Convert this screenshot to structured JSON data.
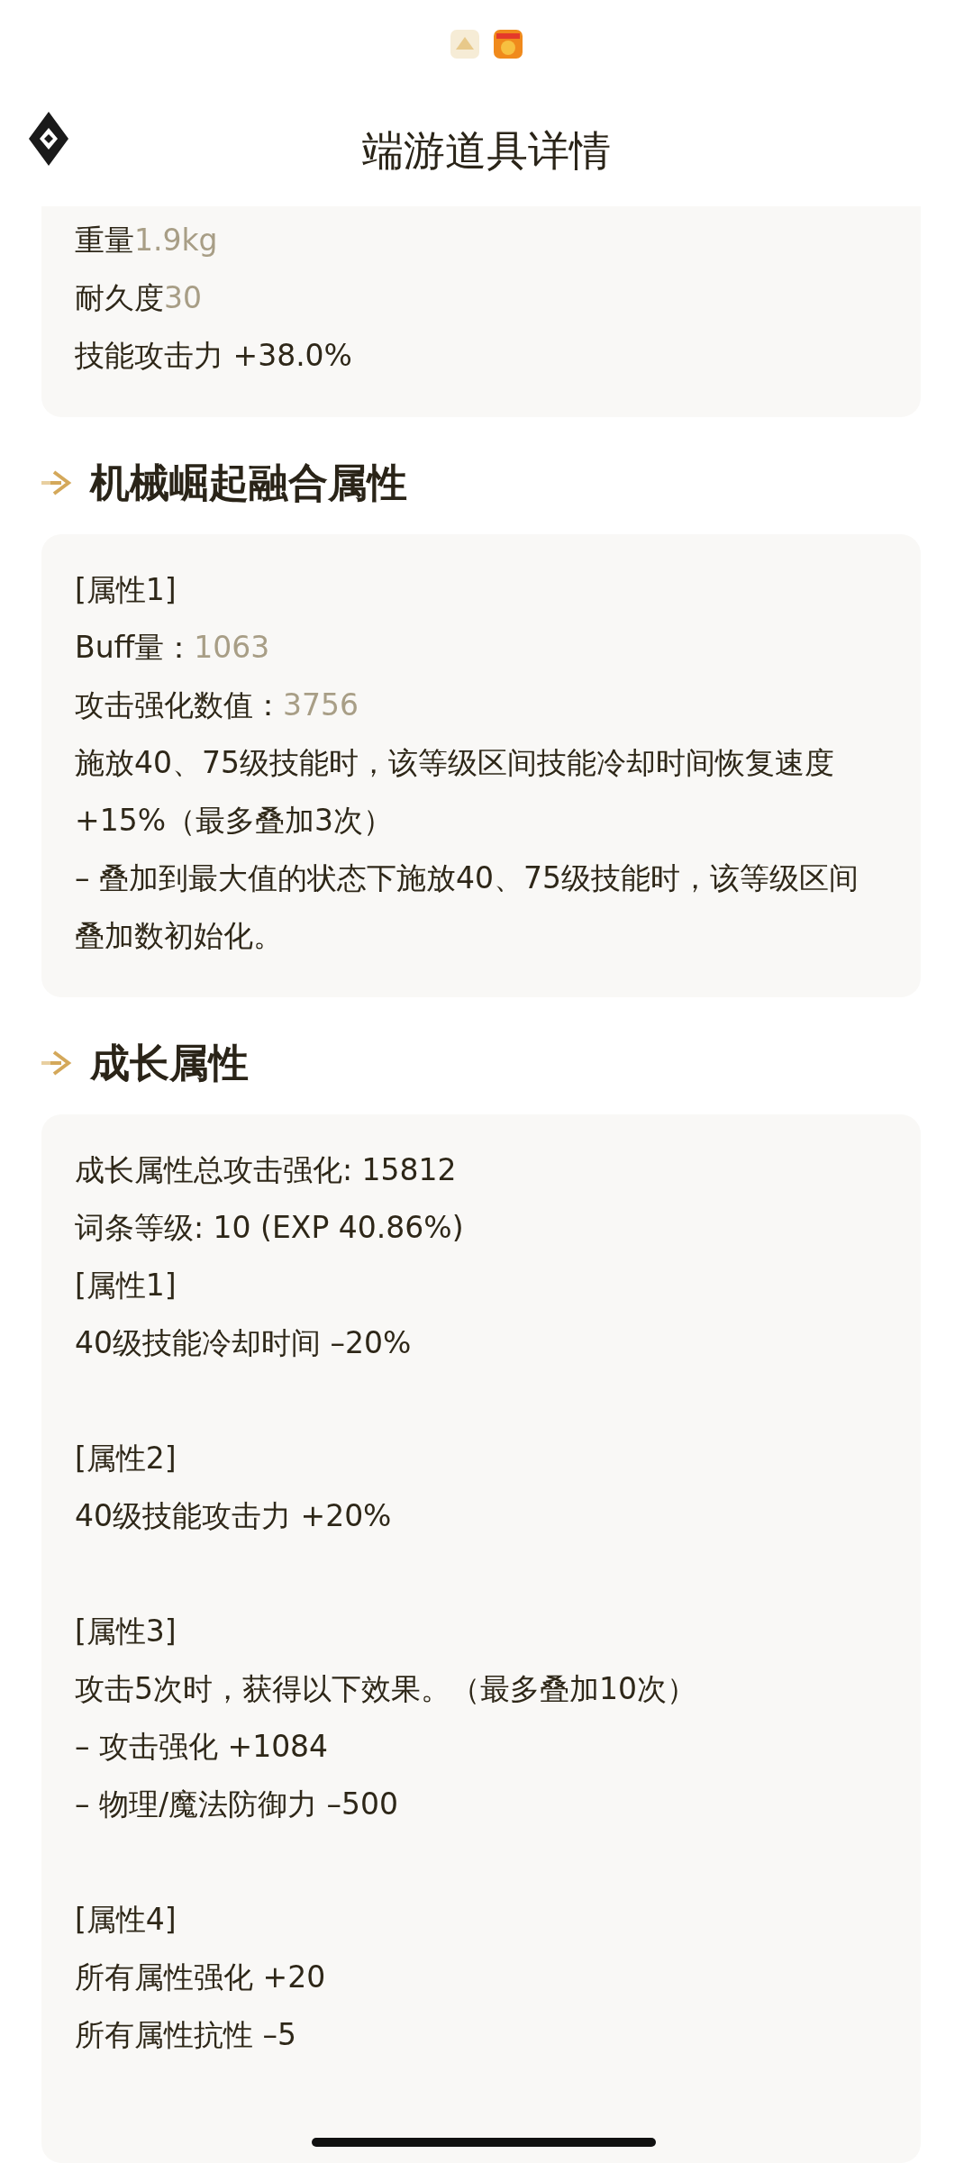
{
  "header": {
    "title": "端游道具详情"
  },
  "sections": [
    {
      "blocks": [
        [
          {
            "text": "重量",
            "value": "1.9kg"
          },
          {
            "text": "耐久度",
            "value": "30"
          },
          {
            "text": "技能攻击力 +38.0%"
          }
        ]
      ]
    },
    {
      "heading": "机械崛起融合属性",
      "blocks": [
        [
          {
            "text": "[属性1]"
          },
          {
            "text": "Buff量：",
            "value": "1063"
          },
          {
            "text": "攻击强化数值：",
            "value": "3756"
          },
          {
            "text": "施放40、75级技能时，该等级区间技能冷却时间恢复速度 +15%（最多叠加3次）"
          },
          {
            "text": "– 叠加到最大值的状态下施放40、75级技能时，该等级区间叠加数初始化。"
          }
        ]
      ]
    },
    {
      "heading": "成长属性",
      "blocks": [
        [
          {
            "text": "成长属性总攻击强化: 15812"
          },
          {
            "text": "词条等级: 10 (EXP 40.86%)"
          },
          {
            "text": "[属性1]"
          },
          {
            "text": "40级技能冷却时间 –20%"
          }
        ],
        [
          {
            "text": "[属性2]"
          },
          {
            "text": "40级技能攻击力 +20%"
          }
        ],
        [
          {
            "text": "[属性3]"
          },
          {
            "text": "攻击5次时，获得以下效果。（最多叠加10次）"
          },
          {
            "text": "– 攻击强化 +1084"
          },
          {
            "text": "– 物理/魔法防御力 –500"
          }
        ],
        [
          {
            "text": "[属性4]"
          },
          {
            "text": "所有属性强化 +20"
          },
          {
            "text": "所有属性抗性 –5"
          }
        ]
      ]
    }
  ]
}
